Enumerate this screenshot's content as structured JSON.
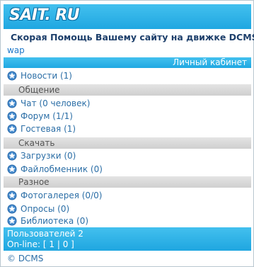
{
  "header": {
    "logo_text": "SAIT. RU",
    "site_title": "Скорая Помощь Вашему сайту на движке DCMS",
    "wap_link": "wap",
    "cabinet_link": "Личный кабинет"
  },
  "menu": {
    "news": "Новости (1)",
    "sections": {
      "communication": "Общение",
      "download": "Скачать",
      "misc": "Разное"
    },
    "chat": "Чат (0 человек)",
    "forum": "Форум (1/1)",
    "guestbook": "Гостевая (1)",
    "downloads": "Загрузки (0)",
    "fileshare": "Файлобменник (0)",
    "gallery": "Фотогалерея (0/0)",
    "polls": "Опросы (0)",
    "library": "Библиотека (0)"
  },
  "footer": {
    "users": "Пользователей 2",
    "online_label": "On-line: ",
    "online_bracket_open": "[ ",
    "online_count1": "1",
    "online_sep": " | ",
    "online_count2": "0",
    "online_bracket_close": " ]",
    "copyright": "© DCMS"
  },
  "colors": {
    "accent": "#20a8e2",
    "section_bg": "#d6d6d6",
    "link": "#2b6ea6",
    "title": "#1d3f6b"
  },
  "icons": {
    "menu_item": "star-icon"
  }
}
